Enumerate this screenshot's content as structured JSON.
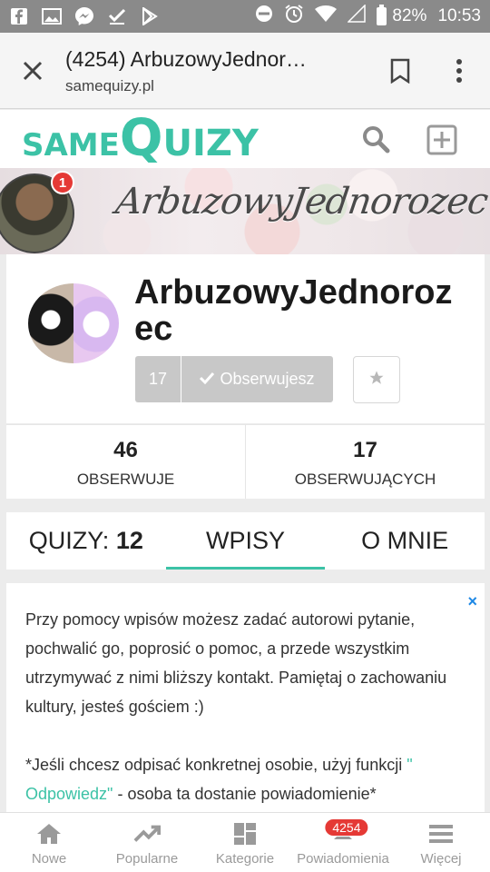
{
  "status_bar": {
    "battery": "82%",
    "time": "10:53",
    "icons": [
      "facebook-icon",
      "gallery-icon",
      "messenger-icon",
      "check-download-icon",
      "play-store-icon",
      "do-not-disturb-icon",
      "alarm-icon",
      "wifi-icon",
      "signal-icon",
      "battery-icon"
    ]
  },
  "browser": {
    "title": "(4254) ArbuzowyJednor…",
    "url": "samequizy.pl"
  },
  "site": {
    "logo_same": "SAME",
    "logo_q": "Q",
    "logo_uizy": "UIZY",
    "accent_color": "#3cc2a6"
  },
  "banner": {
    "text": "ArbuzowyJednorozec",
    "badge_count": "1"
  },
  "profile": {
    "name": "ArbuzowyJednorozec",
    "followers_count_button": "17",
    "follow_label": "Obserwujesz"
  },
  "stats": {
    "following_count": "46",
    "following_label": "OBSERWUJE",
    "followers_count": "17",
    "followers_label": "OBSERWUJĄCYCH"
  },
  "tabs": {
    "quizy_label": "QUIZY:",
    "quizy_count": "12",
    "wpisy": "WPISY",
    "o_mnie": "O MNIE"
  },
  "info": {
    "close": "×",
    "paragraph1": "Przy pomocy wpisów możesz zadać autorowi pytanie, pochwalić go, poprosić o pomoc, a przede wszystkim utrzymywać z nimi bliższy kontakt. Pamiętaj o zachowaniu kultury, jesteś gościem :)",
    "p2_start": "*Jeśli chcesz odpisać konkretnej osobie, użyj funkcji ",
    "p2_link": "\" Odpowiedz\"",
    "p2_end": " - osoba ta dostanie powiadomienie*"
  },
  "bottom_nav": {
    "nowe": "Nowe",
    "popularne": "Popularne",
    "kategorie": "Kategorie",
    "powiadomienia": "Powiadomienia",
    "powiadomienia_badge": "4254",
    "wiecej": "Więcej",
    "icon_color": "#9a9a9a"
  }
}
